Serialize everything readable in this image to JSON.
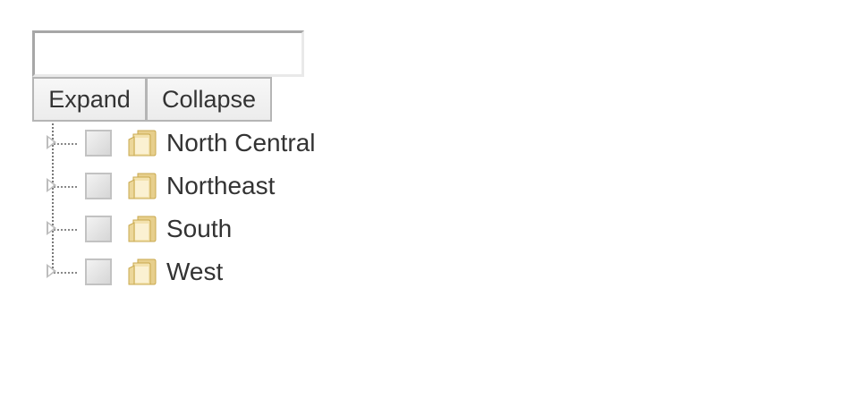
{
  "search": {
    "value": "",
    "placeholder": ""
  },
  "toolbar": {
    "expand_label": "Expand",
    "collapse_label": "Collapse"
  },
  "tree": {
    "nodes": [
      {
        "label": "North Central",
        "checked": false,
        "expanded": false,
        "icon": "folder-icon"
      },
      {
        "label": "Northeast",
        "checked": false,
        "expanded": false,
        "icon": "folder-icon"
      },
      {
        "label": "South",
        "checked": false,
        "expanded": false,
        "icon": "folder-icon"
      },
      {
        "label": "West",
        "checked": false,
        "expanded": false,
        "icon": "folder-icon"
      }
    ]
  }
}
